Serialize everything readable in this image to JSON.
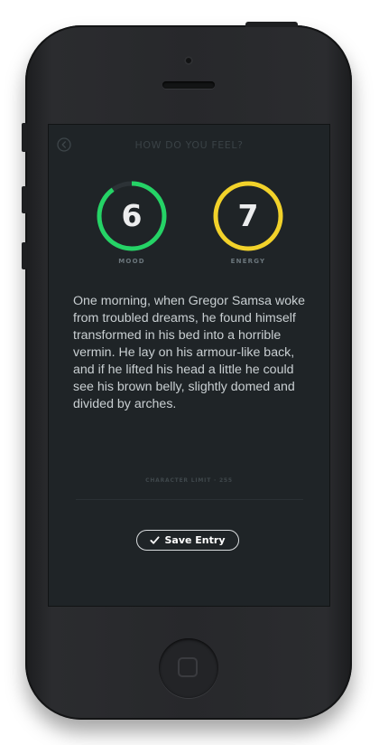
{
  "header": {
    "title": "HOW DO YOU FEEL?",
    "back_icon": "back-arrow-circle-icon"
  },
  "dials": {
    "mood": {
      "value": "6",
      "label": "MOOD",
      "level": 0.9,
      "color": "#25d366"
    },
    "energy": {
      "value": "7",
      "label": "ENERGY",
      "level": 1.0,
      "color": "#f2d22a"
    }
  },
  "entry": {
    "text": "One morning, when Gregor Samsa woke from troubled dreams, he found himself transformed in his bed into a horrible vermin. He lay on his armour-like back, and if he lifted his head a little he could see his brown belly, slightly domed and divided by arches."
  },
  "char_limit": "CHARACTER LIMIT · 255",
  "save": {
    "label": "Save Entry",
    "icon": "check-icon"
  },
  "colors": {
    "screen_bg": "#1f2427",
    "track": "#2c3236",
    "text": "#c9cfd2"
  }
}
